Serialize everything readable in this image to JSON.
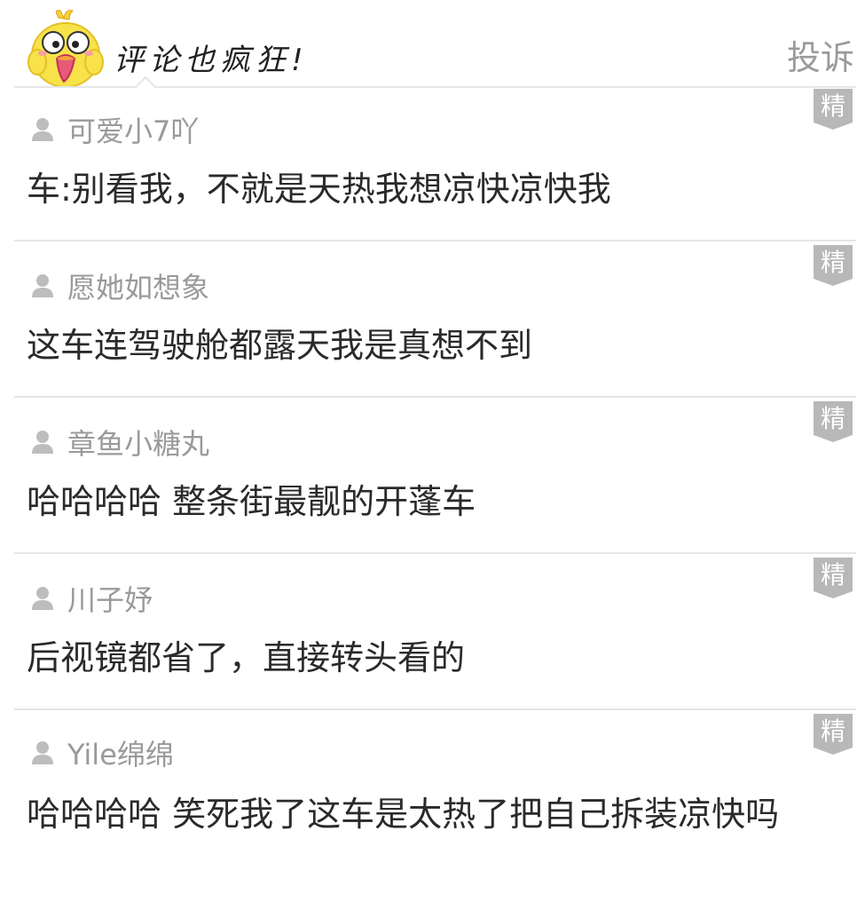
{
  "header": {
    "title": "评论也疯狂!",
    "report_label": "投诉"
  },
  "badge_label": "精",
  "comments": [
    {
      "username": "可爱小7吖",
      "text": "车:别看我，不就是天热我想凉快凉快我"
    },
    {
      "username": "愿她如想象",
      "text": "这车连驾驶舱都露天我是真想不到"
    },
    {
      "username": "章鱼小糖丸",
      "text": "哈哈哈哈 整条街最靓的开蓬车"
    },
    {
      "username": "川子妤",
      "text": "后视镜都省了，直接转头看的"
    },
    {
      "username": "Yile绵绵",
      "text": "哈哈哈哈 笑死我了这车是太热了把自己拆装凉快吗"
    }
  ],
  "colors": {
    "muted_text": "#9a9a9a",
    "body_text": "#2a2a2a",
    "divider": "#e6e6e6",
    "badge_bg": "#b8b8b8",
    "mascot_yellow": "#f7e24a"
  }
}
